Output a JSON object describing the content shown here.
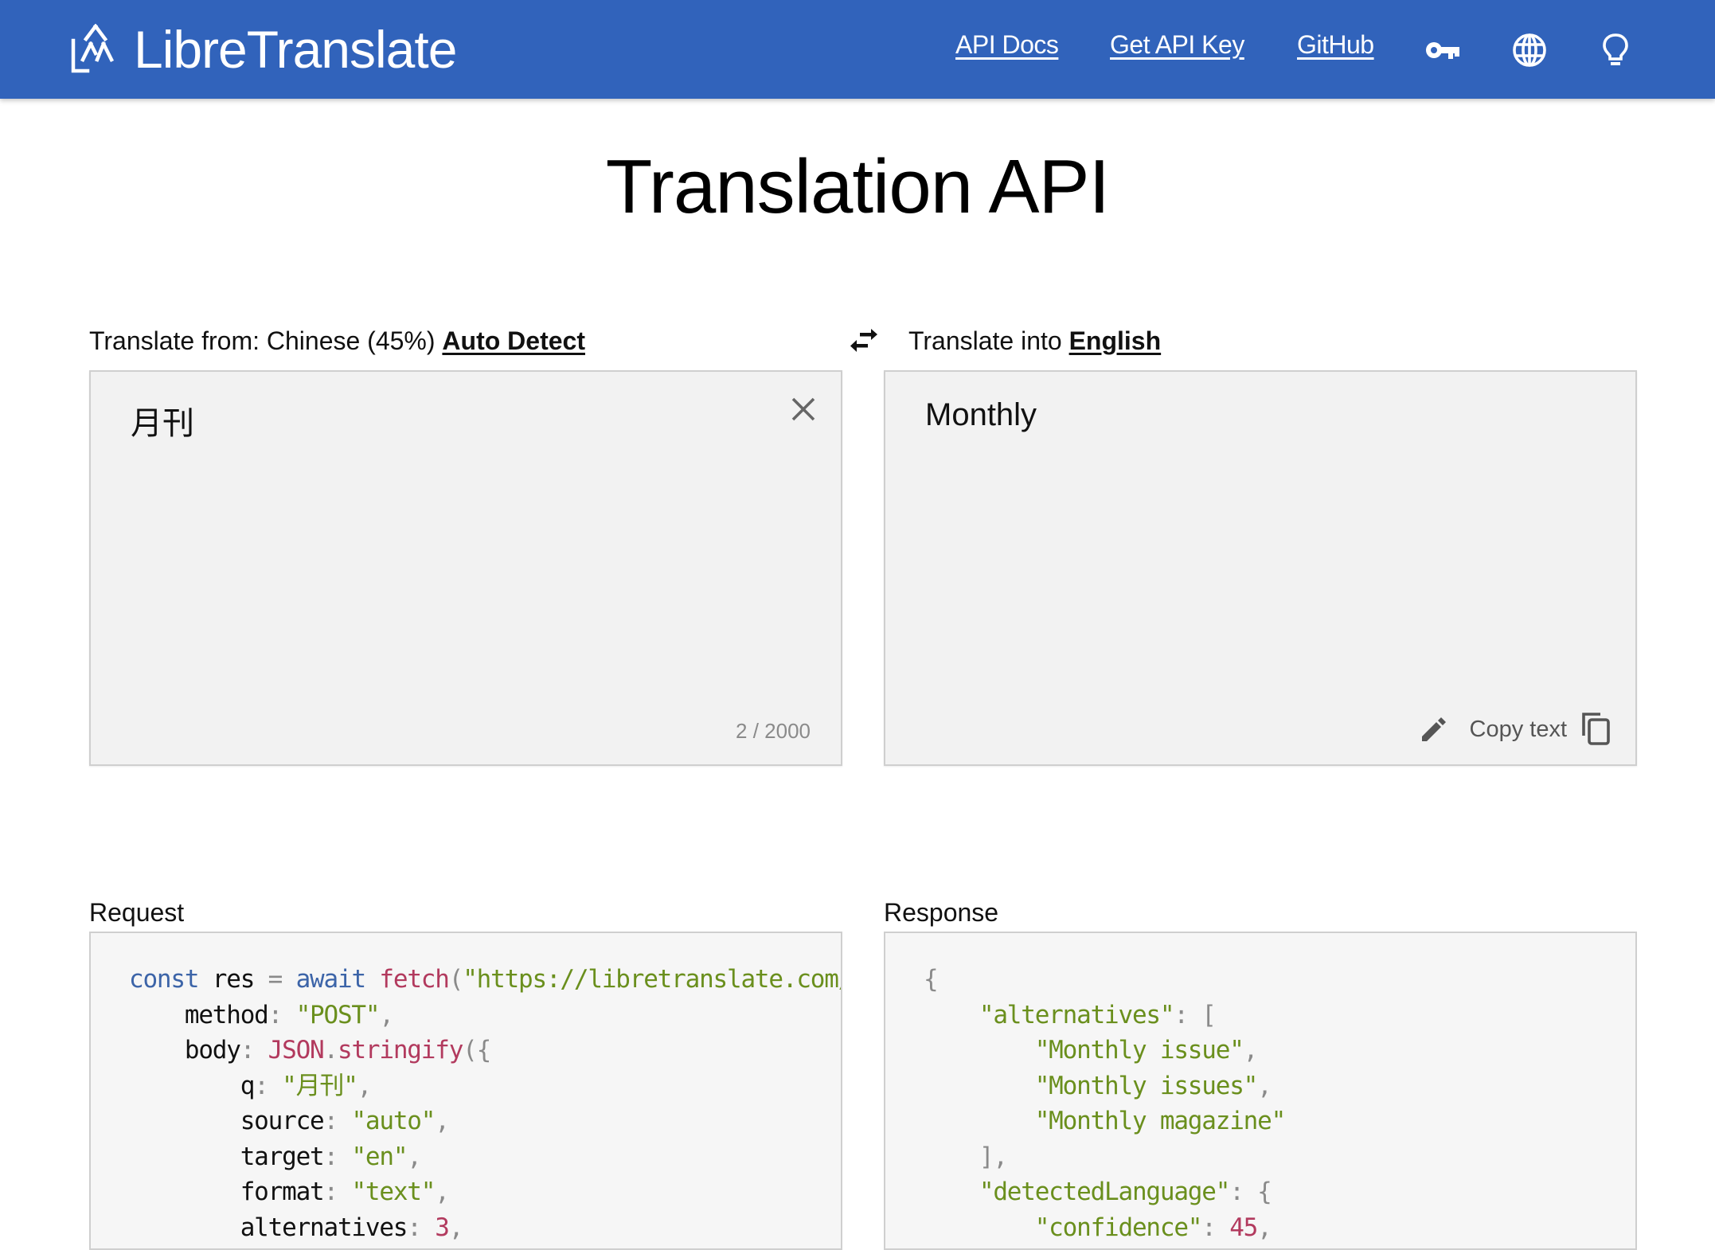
{
  "nav": {
    "brand": "LibreTranslate",
    "links": [
      "API Docs",
      "Get API Key",
      "GitHub"
    ],
    "icons": [
      "key-icon",
      "globe-icon",
      "lightbulb-icon"
    ],
    "background_color": "#3163bb"
  },
  "page": {
    "title": "Translation API"
  },
  "source": {
    "label_prefix": "Translate from: Chinese (45%)",
    "language_link": "Auto Detect",
    "text": "月刊",
    "char_count": "2 / 2000"
  },
  "target": {
    "label_prefix": "Translate into",
    "language_link": "English",
    "text": "Monthly",
    "copy_label": "Copy text"
  },
  "request": {
    "label": "Request",
    "lines": [
      [
        {
          "t": "const",
          "c": "kw"
        },
        {
          "t": " res ",
          "c": "plain"
        },
        {
          "t": "=",
          "c": "punc"
        },
        {
          "t": " ",
          "c": "plain"
        },
        {
          "t": "await",
          "c": "kw"
        },
        {
          "t": " ",
          "c": "plain"
        },
        {
          "t": "fetch",
          "c": "fn"
        },
        {
          "t": "(",
          "c": "punc"
        },
        {
          "t": "\"https://libretranslate.com/",
          "c": "str"
        }
      ],
      [
        {
          "t": "    method",
          "c": "plain"
        },
        {
          "t": ": ",
          "c": "punc"
        },
        {
          "t": "\"POST\"",
          "c": "str"
        },
        {
          "t": ",",
          "c": "punc"
        }
      ],
      [
        {
          "t": "    body",
          "c": "plain"
        },
        {
          "t": ": ",
          "c": "punc"
        },
        {
          "t": "JSON",
          "c": "fn"
        },
        {
          "t": ".",
          "c": "punc"
        },
        {
          "t": "stringify",
          "c": "fn"
        },
        {
          "t": "({",
          "c": "punc"
        }
      ],
      [
        {
          "t": "        q",
          "c": "plain"
        },
        {
          "t": ": ",
          "c": "punc"
        },
        {
          "t": "\"月刊\"",
          "c": "str"
        },
        {
          "t": ",",
          "c": "punc"
        }
      ],
      [
        {
          "t": "        source",
          "c": "plain"
        },
        {
          "t": ": ",
          "c": "punc"
        },
        {
          "t": "\"auto\"",
          "c": "str"
        },
        {
          "t": ",",
          "c": "punc"
        }
      ],
      [
        {
          "t": "        target",
          "c": "plain"
        },
        {
          "t": ": ",
          "c": "punc"
        },
        {
          "t": "\"en\"",
          "c": "str"
        },
        {
          "t": ",",
          "c": "punc"
        }
      ],
      [
        {
          "t": "        format",
          "c": "plain"
        },
        {
          "t": ": ",
          "c": "punc"
        },
        {
          "t": "\"text\"",
          "c": "str"
        },
        {
          "t": ",",
          "c": "punc"
        }
      ],
      [
        {
          "t": "        alternatives",
          "c": "plain"
        },
        {
          "t": ": ",
          "c": "punc"
        },
        {
          "t": "3",
          "c": "num"
        },
        {
          "t": ",",
          "c": "punc"
        }
      ]
    ]
  },
  "response": {
    "label": "Response",
    "lines": [
      [
        {
          "t": "{",
          "c": "punc"
        }
      ],
      [
        {
          "t": "    \"alternatives\"",
          "c": "str"
        },
        {
          "t": ": [",
          "c": "punc"
        }
      ],
      [
        {
          "t": "        \"Monthly issue\"",
          "c": "str"
        },
        {
          "t": ",",
          "c": "punc"
        }
      ],
      [
        {
          "t": "        \"Monthly issues\"",
          "c": "str"
        },
        {
          "t": ",",
          "c": "punc"
        }
      ],
      [
        {
          "t": "        \"Monthly magazine\"",
          "c": "str"
        }
      ],
      [
        {
          "t": "    ],",
          "c": "punc"
        }
      ],
      [
        {
          "t": "    \"detectedLanguage\"",
          "c": "str"
        },
        {
          "t": ": {",
          "c": "punc"
        }
      ],
      [
        {
          "t": "        \"confidence\"",
          "c": "str"
        },
        {
          "t": ": ",
          "c": "punc"
        },
        {
          "t": "45",
          "c": "num"
        },
        {
          "t": ",",
          "c": "punc"
        }
      ]
    ]
  }
}
